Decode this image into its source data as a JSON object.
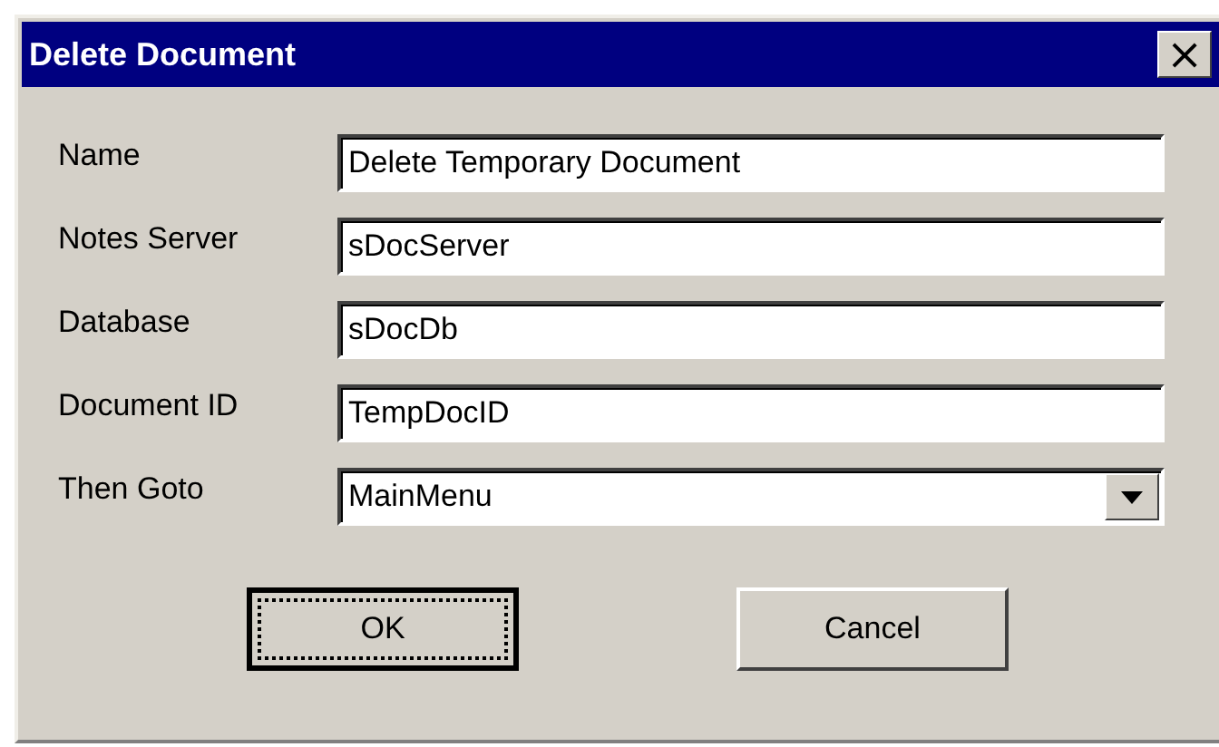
{
  "window": {
    "title": "Delete Document",
    "close_symbol": "×"
  },
  "fields": [
    {
      "kind": "text",
      "label": "Name",
      "value": "Delete Temporary Document"
    },
    {
      "kind": "text",
      "label": "Notes Server",
      "value": "sDocServer"
    },
    {
      "kind": "text",
      "label": "Database",
      "value": "sDocDb"
    },
    {
      "kind": "text",
      "label": "Document ID",
      "value": "TempDocID"
    },
    {
      "kind": "dropdown",
      "label": "Then Goto",
      "value": "MainMenu"
    }
  ],
  "buttons": [
    {
      "label": "OK",
      "focused": true
    },
    {
      "label": "Cancel",
      "focused": false
    }
  ]
}
